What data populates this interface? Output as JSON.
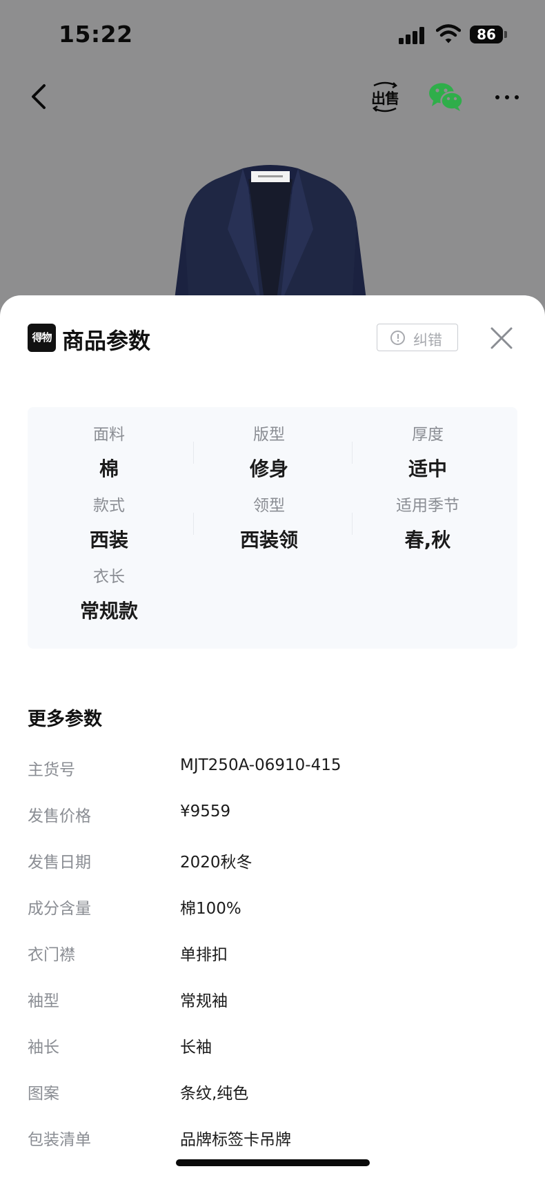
{
  "status_bar": {
    "time": "15:22",
    "battery": "86"
  },
  "nav": {
    "back_icon": "chevron-left-icon",
    "sell_label": "出售",
    "share_icon": "wechat-icon",
    "more_icon": "more-dots-icon"
  },
  "sheet": {
    "logo_text": "得物",
    "title": "商品参数",
    "report_label": "纠错",
    "close_icon": "close-icon",
    "params": [
      {
        "label": "面料",
        "value": "棉"
      },
      {
        "label": "版型",
        "value": "修身"
      },
      {
        "label": "厚度",
        "value": "适中"
      },
      {
        "label": "款式",
        "value": "西装"
      },
      {
        "label": "领型",
        "value": "西装领"
      },
      {
        "label": "适用季节",
        "value": "春,秋"
      },
      {
        "label": "衣长",
        "value": "常规款"
      }
    ],
    "more_title": "更多参数",
    "more_params": [
      {
        "key": "主货号",
        "value": "MJT250A-06910-415"
      },
      {
        "key": "发售价格",
        "value": "¥9559"
      },
      {
        "key": "发售日期",
        "value": "2020秋冬"
      },
      {
        "key": "成分含量",
        "value": "棉100%"
      },
      {
        "key": "衣门襟",
        "value": "单排扣"
      },
      {
        "key": "袖型",
        "value": "常规袖"
      },
      {
        "key": "袖长",
        "value": "长袖"
      },
      {
        "key": "图案",
        "value": "条纹,纯色"
      },
      {
        "key": "包装清单",
        "value": "品牌标签卡吊牌"
      }
    ]
  },
  "colors": {
    "overlay": "#8e8e8f",
    "card_bg": "#f7f9fc",
    "label_gray": "#8a8d93",
    "wechat_green": "#2fae4a"
  }
}
